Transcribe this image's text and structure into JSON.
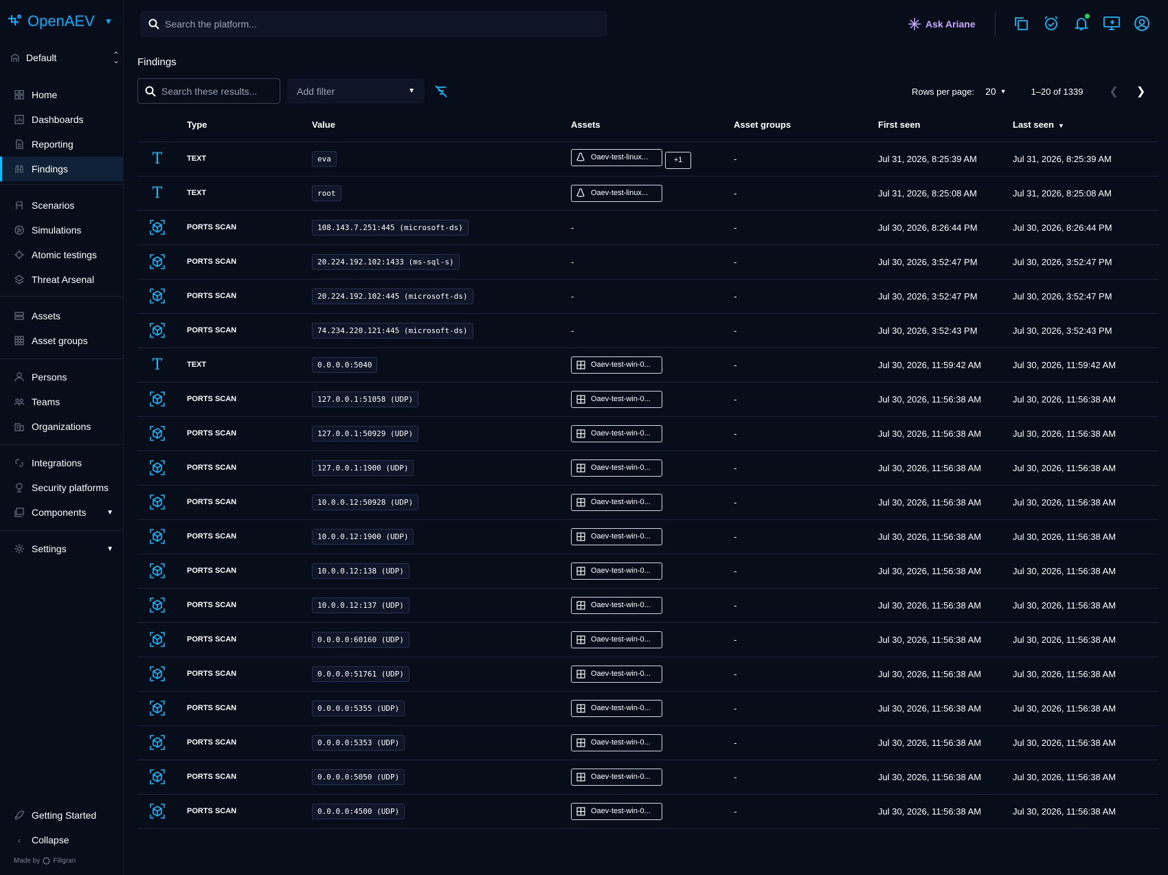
{
  "app": {
    "name": "OpenAEV"
  },
  "workspace": {
    "label": "Default"
  },
  "sidebar": {
    "items": [
      {
        "label": "Home",
        "icon": "home-icon"
      },
      {
        "label": "Dashboards",
        "icon": "dashboards-icon"
      },
      {
        "label": "Reporting",
        "icon": "reporting-icon"
      },
      {
        "label": "Findings",
        "icon": "findings-icon"
      },
      {
        "label": "Scenarios",
        "icon": "scenarios-icon"
      },
      {
        "label": "Simulations",
        "icon": "simulations-icon"
      },
      {
        "label": "Atomic testings",
        "icon": "atomic-testings-icon"
      },
      {
        "label": "Threat Arsenal",
        "icon": "threat-arsenal-icon"
      },
      {
        "label": "Assets",
        "icon": "assets-icon"
      },
      {
        "label": "Asset groups",
        "icon": "asset-groups-icon"
      },
      {
        "label": "Persons",
        "icon": "persons-icon"
      },
      {
        "label": "Teams",
        "icon": "teams-icon"
      },
      {
        "label": "Organizations",
        "icon": "organizations-icon"
      },
      {
        "label": "Integrations",
        "icon": "integrations-icon"
      },
      {
        "label": "Security platforms",
        "icon": "security-platforms-icon"
      },
      {
        "label": "Components",
        "icon": "components-icon"
      },
      {
        "label": "Settings",
        "icon": "settings-icon"
      }
    ],
    "bottom": {
      "getting_started": "Getting Started",
      "collapse": "Collapse"
    },
    "made_by": "Made by",
    "made_by_brand": "Filigran"
  },
  "topbar": {
    "search_placeholder": "Search the platform...",
    "ask_ariane": "Ask Ariane"
  },
  "page": {
    "title": "Findings",
    "search_placeholder": "Search these results...",
    "add_filter": "Add filter",
    "rows_per_page_label": "Rows per page:",
    "rows_per_page_value": "20",
    "range": "1–20 of 1339"
  },
  "columns": [
    "Type",
    "Value",
    "Assets",
    "Asset groups",
    "First seen",
    "Last seen"
  ],
  "rows": [
    {
      "type": "TEXT",
      "kind": "text",
      "value": "eva",
      "asset": "Oaev-test-linux...",
      "os": "linux",
      "extra": "+1",
      "groups": "-",
      "first": "Jul 31, 2026, 8:25:39 AM",
      "last": "Jul 31, 2026, 8:25:39 AM"
    },
    {
      "type": "TEXT",
      "kind": "text",
      "value": "root",
      "asset": "Oaev-test-linux...",
      "os": "linux",
      "extra": "",
      "groups": "-",
      "first": "Jul 31, 2026, 8:25:08 AM",
      "last": "Jul 31, 2026, 8:25:08 AM"
    },
    {
      "type": "PORTS SCAN",
      "kind": "scan",
      "value": "108.143.7.251:445 (microsoft-ds)",
      "asset": "-",
      "os": "",
      "extra": "",
      "groups": "-",
      "first": "Jul 30, 2026, 8:26:44 PM",
      "last": "Jul 30, 2026, 8:26:44 PM"
    },
    {
      "type": "PORTS SCAN",
      "kind": "scan",
      "value": "20.224.192.102:1433 (ms-sql-s)",
      "asset": "-",
      "os": "",
      "extra": "",
      "groups": "-",
      "first": "Jul 30, 2026, 3:52:47 PM",
      "last": "Jul 30, 2026, 3:52:47 PM"
    },
    {
      "type": "PORTS SCAN",
      "kind": "scan",
      "value": "20.224.192.102:445 (microsoft-ds)",
      "asset": "-",
      "os": "",
      "extra": "",
      "groups": "-",
      "first": "Jul 30, 2026, 3:52:47 PM",
      "last": "Jul 30, 2026, 3:52:47 PM"
    },
    {
      "type": "PORTS SCAN",
      "kind": "scan",
      "value": "74.234.220.121:445 (microsoft-ds)",
      "asset": "-",
      "os": "",
      "extra": "",
      "groups": "-",
      "first": "Jul 30, 2026, 3:52:43 PM",
      "last": "Jul 30, 2026, 3:52:43 PM"
    },
    {
      "type": "TEXT",
      "kind": "text",
      "value": "0.0.0.0:5040",
      "asset": "Oaev-test-win-0...",
      "os": "windows",
      "extra": "",
      "groups": "-",
      "first": "Jul 30, 2026, 11:59:42 AM",
      "last": "Jul 30, 2026, 11:59:42 AM"
    },
    {
      "type": "PORTS SCAN",
      "kind": "scan",
      "value": "127.0.0.1:51058 (UDP)",
      "asset": "Oaev-test-win-0...",
      "os": "windows",
      "extra": "",
      "groups": "-",
      "first": "Jul 30, 2026, 11:56:38 AM",
      "last": "Jul 30, 2026, 11:56:38 AM"
    },
    {
      "type": "PORTS SCAN",
      "kind": "scan",
      "value": "127.0.0.1:50929 (UDP)",
      "asset": "Oaev-test-win-0...",
      "os": "windows",
      "extra": "",
      "groups": "-",
      "first": "Jul 30, 2026, 11:56:38 AM",
      "last": "Jul 30, 2026, 11:56:38 AM"
    },
    {
      "type": "PORTS SCAN",
      "kind": "scan",
      "value": "127.0.0.1:1900 (UDP)",
      "asset": "Oaev-test-win-0...",
      "os": "windows",
      "extra": "",
      "groups": "-",
      "first": "Jul 30, 2026, 11:56:38 AM",
      "last": "Jul 30, 2026, 11:56:38 AM"
    },
    {
      "type": "PORTS SCAN",
      "kind": "scan",
      "value": "10.0.0.12:50928 (UDP)",
      "asset": "Oaev-test-win-0...",
      "os": "windows",
      "extra": "",
      "groups": "-",
      "first": "Jul 30, 2026, 11:56:38 AM",
      "last": "Jul 30, 2026, 11:56:38 AM"
    },
    {
      "type": "PORTS SCAN",
      "kind": "scan",
      "value": "10.0.0.12:1900 (UDP)",
      "asset": "Oaev-test-win-0...",
      "os": "windows",
      "extra": "",
      "groups": "-",
      "first": "Jul 30, 2026, 11:56:38 AM",
      "last": "Jul 30, 2026, 11:56:38 AM"
    },
    {
      "type": "PORTS SCAN",
      "kind": "scan",
      "value": "10.0.0.12:138 (UDP)",
      "asset": "Oaev-test-win-0...",
      "os": "windows",
      "extra": "",
      "groups": "-",
      "first": "Jul 30, 2026, 11:56:38 AM",
      "last": "Jul 30, 2026, 11:56:38 AM"
    },
    {
      "type": "PORTS SCAN",
      "kind": "scan",
      "value": "10.0.0.12:137 (UDP)",
      "asset": "Oaev-test-win-0...",
      "os": "windows",
      "extra": "",
      "groups": "-",
      "first": "Jul 30, 2026, 11:56:38 AM",
      "last": "Jul 30, 2026, 11:56:38 AM"
    },
    {
      "type": "PORTS SCAN",
      "kind": "scan",
      "value": "0.0.0.0:60160 (UDP)",
      "asset": "Oaev-test-win-0...",
      "os": "windows",
      "extra": "",
      "groups": "-",
      "first": "Jul 30, 2026, 11:56:38 AM",
      "last": "Jul 30, 2026, 11:56:38 AM"
    },
    {
      "type": "PORTS SCAN",
      "kind": "scan",
      "value": "0.0.0.0:51761 (UDP)",
      "asset": "Oaev-test-win-0...",
      "os": "windows",
      "extra": "",
      "groups": "-",
      "first": "Jul 30, 2026, 11:56:38 AM",
      "last": "Jul 30, 2026, 11:56:38 AM"
    },
    {
      "type": "PORTS SCAN",
      "kind": "scan",
      "value": "0.0.0.0:5355 (UDP)",
      "asset": "Oaev-test-win-0...",
      "os": "windows",
      "extra": "",
      "groups": "-",
      "first": "Jul 30, 2026, 11:56:38 AM",
      "last": "Jul 30, 2026, 11:56:38 AM"
    },
    {
      "type": "PORTS SCAN",
      "kind": "scan",
      "value": "0.0.0.0:5353 (UDP)",
      "asset": "Oaev-test-win-0...",
      "os": "windows",
      "extra": "",
      "groups": "-",
      "first": "Jul 30, 2026, 11:56:38 AM",
      "last": "Jul 30, 2026, 11:56:38 AM"
    },
    {
      "type": "PORTS SCAN",
      "kind": "scan",
      "value": "0.0.0.0:5050 (UDP)",
      "asset": "Oaev-test-win-0...",
      "os": "windows",
      "extra": "",
      "groups": "-",
      "first": "Jul 30, 2026, 11:56:38 AM",
      "last": "Jul 30, 2026, 11:56:38 AM"
    },
    {
      "type": "PORTS SCAN",
      "kind": "scan",
      "value": "0.0.0.0:4500 (UDP)",
      "asset": "Oaev-test-win-0...",
      "os": "windows",
      "extra": "",
      "groups": "-",
      "first": "Jul 30, 2026, 11:56:38 AM",
      "last": "Jul 30, 2026, 11:56:38 AM"
    }
  ],
  "colors": {
    "accent": "#0fbcff",
    "background": "#070d19",
    "ariane": "#c8a7ff",
    "notification": "#1ed760"
  }
}
